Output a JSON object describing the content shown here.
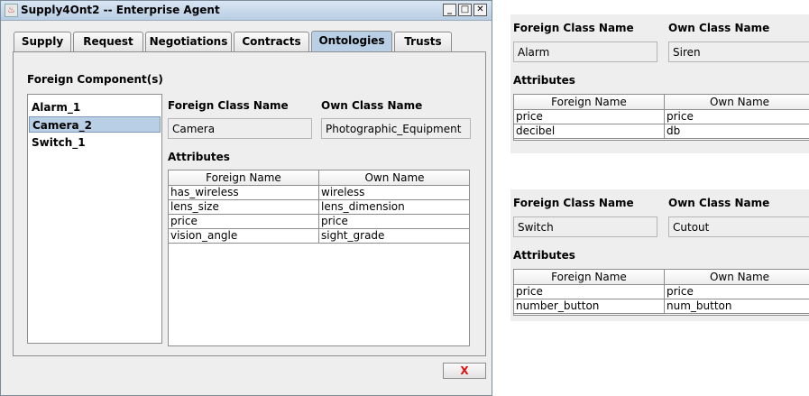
{
  "window": {
    "title": "Supply4Ont2 -- Enterprise Agent",
    "minimize_glyph": "_",
    "maximize_glyph": "□",
    "close_glyph": "✕"
  },
  "tabs": [
    {
      "label": "Supply"
    },
    {
      "label": "Request"
    },
    {
      "label": "Negotiations"
    },
    {
      "label": "Contracts"
    },
    {
      "label": "Ontologies",
      "active": true
    },
    {
      "label": "Trusts"
    }
  ],
  "main": {
    "components_label": "Foreign Component(s)",
    "components": [
      {
        "label": "Alarm_1"
      },
      {
        "label": "Camera_2",
        "selected": true
      },
      {
        "label": "Switch_1"
      }
    ],
    "foreign_class_label": "Foreign Class Name",
    "own_class_label": "Own Class Name",
    "foreign_class_value": "Camera",
    "own_class_value": "Photographic_Equipment",
    "attributes_label": "Attributes",
    "attr_headers": [
      "Foreign Name",
      "Own Name"
    ],
    "attr_rows": [
      [
        "has_wireless",
        "wireless"
      ],
      [
        "lens_size",
        "lens_dimension"
      ],
      [
        "price",
        "price"
      ],
      [
        "vision_angle",
        "sight_grade"
      ]
    ],
    "close_button_label": "X"
  },
  "panel_alarm": {
    "foreign_class_label": "Foreign Class Name",
    "own_class_label": "Own Class Name",
    "foreign_class_value": "Alarm",
    "own_class_value": "Siren",
    "attributes_label": "Attributes",
    "attr_headers": [
      "Foreign Name",
      "Own Name"
    ],
    "attr_rows": [
      [
        "price",
        "price"
      ],
      [
        "decibel",
        "db"
      ]
    ]
  },
  "panel_switch": {
    "foreign_class_label": "Foreign Class Name",
    "own_class_label": "Own Class Name",
    "foreign_class_value": "Switch",
    "own_class_value": "Cutout",
    "attributes_label": "Attributes",
    "attr_headers": [
      "Foreign Name",
      "Own Name"
    ],
    "attr_rows": [
      [
        "price",
        "price"
      ],
      [
        "number_button",
        "num_button"
      ]
    ]
  }
}
